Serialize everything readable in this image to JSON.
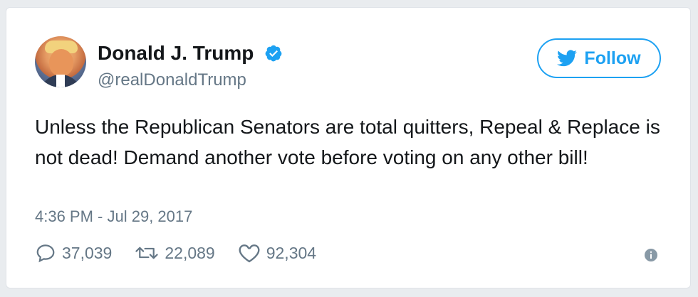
{
  "author": {
    "display_name": "Donald J. Trump",
    "handle": "@realDonaldTrump",
    "verified": true,
    "avatar_icon": "profile-photo"
  },
  "follow_button": {
    "label": "Follow",
    "icon": "twitter-bird-icon"
  },
  "tweet": {
    "text": "Unless the Republican Senators are total quitters, Repeal & Replace is not dead! Demand another vote before voting on any other bill!",
    "timestamp": "4:36 PM - Jul 29, 2017"
  },
  "stats": {
    "replies": "37,039",
    "retweets": "22,089",
    "likes": "92,304"
  },
  "colors": {
    "accent": "#1da1f2",
    "secondary_text": "#657786",
    "primary_text": "#14171a"
  }
}
